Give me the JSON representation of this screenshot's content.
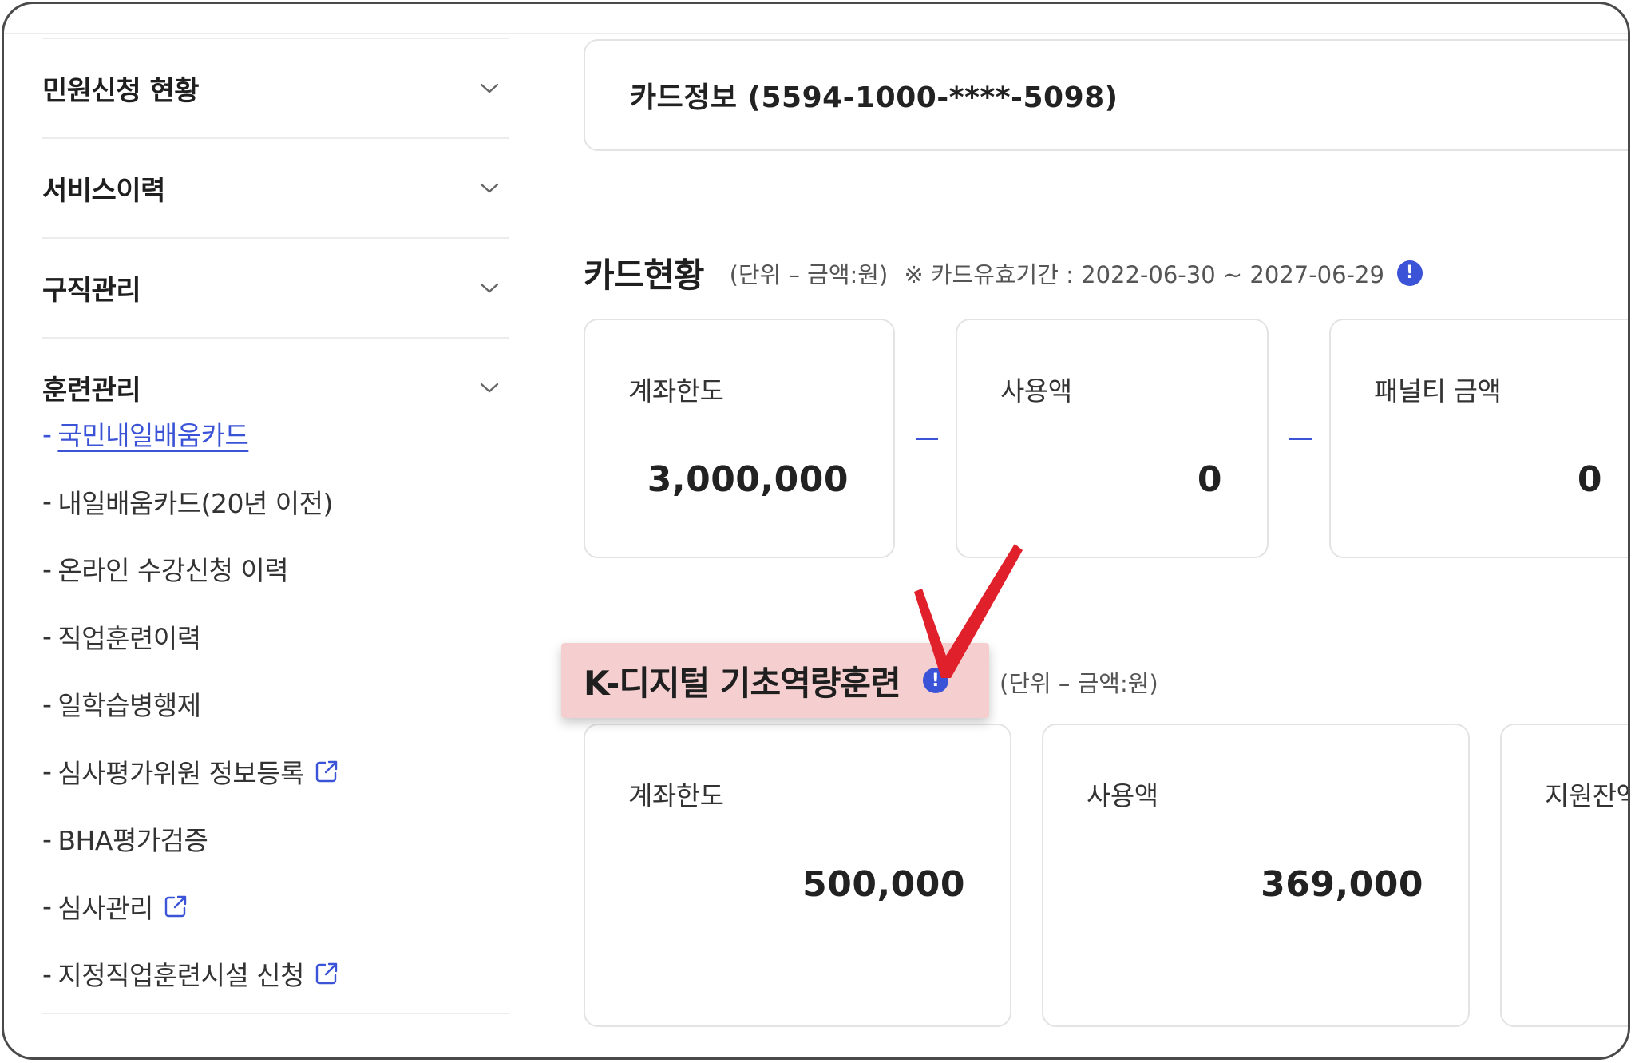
{
  "sidebar": {
    "sections": [
      {
        "label": "민원신청 현황"
      },
      {
        "label": "서비스이력"
      },
      {
        "label": "구직관리"
      },
      {
        "label": "훈련관리"
      }
    ],
    "training_items": [
      {
        "label": "국민내일배움카드",
        "active": true,
        "external": false
      },
      {
        "label": "내일배움카드(20년 이전)",
        "external": false
      },
      {
        "label": "온라인 수강신청 이력",
        "external": false
      },
      {
        "label": "직업훈련이력",
        "external": false
      },
      {
        "label": "일학습병행제",
        "external": false
      },
      {
        "label": "심사평가위원 정보등록",
        "external": true
      },
      {
        "label": "BHA평가검증",
        "external": false
      },
      {
        "label": "심사관리",
        "external": true
      },
      {
        "label": "지정직업훈련시설 신청",
        "external": true
      }
    ],
    "dash": "-"
  },
  "card_info": {
    "text": "카드정보 (5594-1000-****-5098)"
  },
  "card_status": {
    "title": "카드현황",
    "unit": "(단위 – 금액:원)",
    "validity": "※ 카드유효기간 : 2022-06-30 ~ 2027-06-29",
    "boxes": [
      {
        "label": "계좌한도",
        "value": "3,000,000"
      },
      {
        "label": "사용액",
        "value": "0"
      },
      {
        "label": "패널티 금액",
        "value": "0"
      }
    ]
  },
  "k_digital": {
    "title": "K-디지털 기초역량훈련",
    "unit": "(단위 – 금액:원)",
    "boxes": [
      {
        "label": "계좌한도",
        "value": "500,000"
      },
      {
        "label": "사용액",
        "value": "369,000"
      },
      {
        "label": "지원잔액",
        "value": ""
      }
    ]
  },
  "info_icon_glyph": "!",
  "colors": {
    "accent": "#3b53d6",
    "highlight": "#f5cfcf",
    "check": "#e0202a"
  }
}
